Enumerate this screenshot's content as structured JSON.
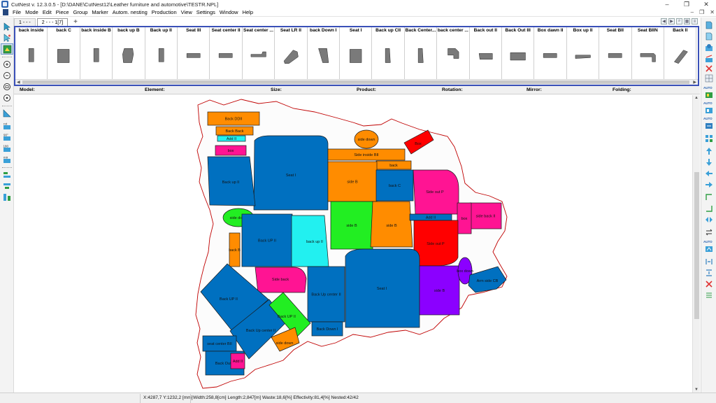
{
  "window": {
    "title": "CutNest v. 12.3.0.5 - [D:\\DANE\\CutNest12\\Leather furniture and automotive\\TESTR.NPL]",
    "controls": [
      "–",
      "❐",
      "✕"
    ]
  },
  "menu": {
    "items": [
      "File",
      "Mode",
      "Edit",
      "Piece",
      "Group",
      "Marker",
      "Autom. nesting",
      "Production",
      "View",
      "Settings",
      "Window",
      "Help"
    ],
    "mdi_controls": [
      "–",
      "❐",
      "✕"
    ]
  },
  "tabs": [
    {
      "label": "1 - - -",
      "active": false
    },
    {
      "label": "2 - - - 1[7]",
      "active": true
    }
  ],
  "tab_add_label": "+",
  "element_strip": [
    {
      "label": "back inside",
      "shape": "tall"
    },
    {
      "label": "back C",
      "shape": "square"
    },
    {
      "label": "back inside B",
      "shape": "tall"
    },
    {
      "label": "back up B",
      "shape": "blob"
    },
    {
      "label": "Back up II",
      "shape": "tall"
    },
    {
      "label": "Seat III",
      "shape": "flat"
    },
    {
      "label": "Seat center II",
      "shape": "flat"
    },
    {
      "label": "Seat center ...",
      "shape": "flatl"
    },
    {
      "label": "Seat LR II",
      "shape": "diag"
    },
    {
      "label": "back Down I",
      "shape": "wedge"
    },
    {
      "label": "Seat I",
      "shape": "square"
    },
    {
      "label": "Back up CII",
      "shape": "slim"
    },
    {
      "label": "Back Center...",
      "shape": "slim"
    },
    {
      "label": "back center ...",
      "shape": "hook"
    },
    {
      "label": "Back out II",
      "shape": "flat2"
    },
    {
      "label": "Back Out III",
      "shape": "flat3"
    },
    {
      "label": "Box dawn II",
      "shape": "flat"
    },
    {
      "label": "Box up II",
      "shape": "flatthin"
    },
    {
      "label": "Seat BII",
      "shape": "flat"
    },
    {
      "label": "Seat BIIN",
      "shape": "flatl2"
    },
    {
      "label": "Back II",
      "shape": "diag2"
    }
  ],
  "info_header": {
    "model": "Model:",
    "element": "Element:",
    "size": "Size:",
    "product": "Product:",
    "rotation": "Rotation:",
    "mirror": "Mirror:",
    "folding": "Folding:"
  },
  "colors": {
    "blue": "#0070c0",
    "orange": "#ff8c00",
    "green": "#22ee22",
    "cyan": "#22f0f0",
    "pink": "#ff1493",
    "red": "#ff0000",
    "purple": "#8b00ff",
    "outline": "#c00000",
    "strip_border": "#3a50b8"
  },
  "pieces": [
    {
      "label": "Back DDII",
      "color": "orange"
    },
    {
      "label": "Back Back",
      "color": "orange"
    },
    {
      "label": "Add II",
      "color": "cyan"
    },
    {
      "label": "box",
      "color": "pink"
    },
    {
      "label": "Seat I",
      "color": "blue"
    },
    {
      "label": "Back up II",
      "color": "blue"
    },
    {
      "label": "side down",
      "color": "orange"
    },
    {
      "label": "Side inside BII",
      "color": "orange"
    },
    {
      "label": "back",
      "color": "orange"
    },
    {
      "label": "Box",
      "color": "red"
    },
    {
      "label": "side B",
      "color": "orange"
    },
    {
      "label": "back C",
      "color": "blue"
    },
    {
      "label": "Side out P",
      "color": "pink"
    },
    {
      "label": "side down",
      "color": "green"
    },
    {
      "label": "side B",
      "color": "green"
    },
    {
      "label": "side B",
      "color": "orange"
    },
    {
      "label": "Add II",
      "color": "blue"
    },
    {
      "label": "side back II",
      "color": "pink"
    },
    {
      "label": "box",
      "color": "pink"
    },
    {
      "label": "Back UP II",
      "color": "blue"
    },
    {
      "label": "back up II",
      "color": "cyan"
    },
    {
      "label": "Side out P",
      "color": "red"
    },
    {
      "label": "back B",
      "color": "orange"
    },
    {
      "label": "Seat I",
      "color": "blue"
    },
    {
      "label": "side B",
      "color": "purple"
    },
    {
      "label": "box down",
      "color": "purple"
    },
    {
      "label": "Arm side CB",
      "color": "blue"
    },
    {
      "label": "Side back",
      "color": "pink"
    },
    {
      "label": "Back Up center II",
      "color": "blue"
    },
    {
      "label": "Back UP II",
      "color": "blue"
    },
    {
      "label": "Back Up center II",
      "color": "blue"
    },
    {
      "label": "Back UP II",
      "color": "green"
    },
    {
      "label": "Back Down I",
      "color": "blue"
    },
    {
      "label": "side down",
      "color": "orange"
    },
    {
      "label": "seat center BII",
      "color": "blue"
    },
    {
      "label": "Back Out II",
      "color": "blue"
    },
    {
      "label": "Add II",
      "color": "pink"
    }
  ],
  "status": {
    "coords": "X:4287,7  Y:1232,2 [mm]",
    "metrics": "Width:258,8[cm]  Length:2,847[m]  Waste:18,6[%]  Effectivity:81,4[%]  Nested:42/42"
  }
}
